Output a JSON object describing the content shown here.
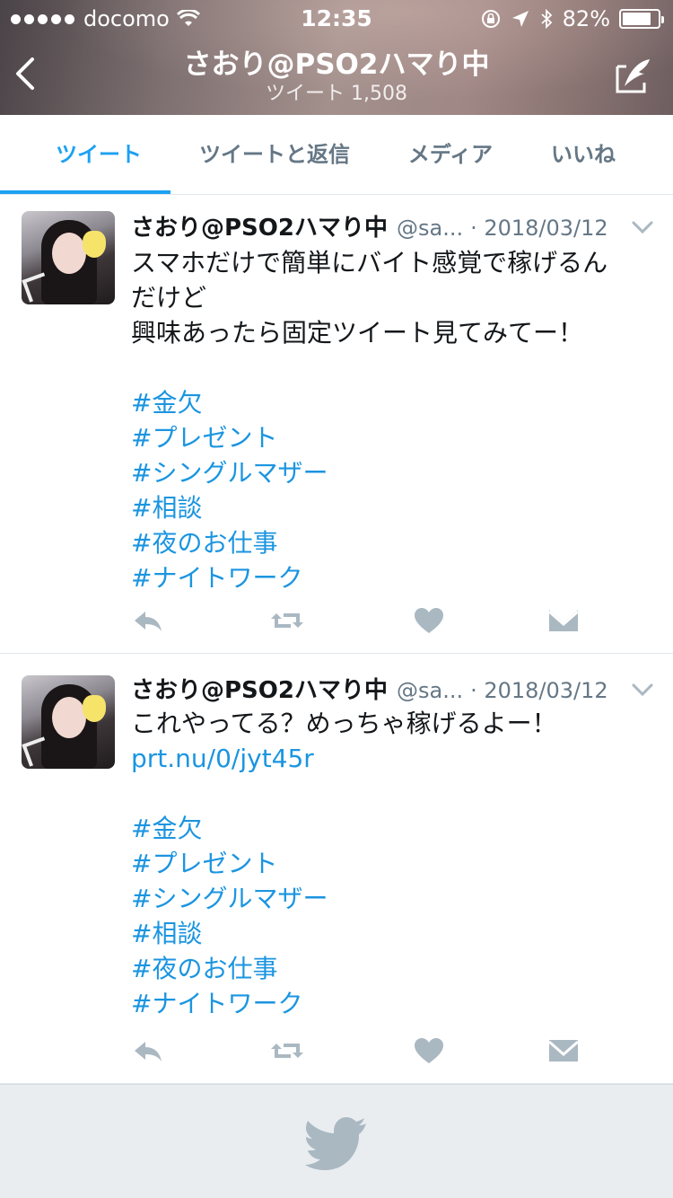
{
  "status_bar": {
    "carrier": "docomo",
    "time": "12:35",
    "battery": "82%",
    "battery_level": 0.82
  },
  "header": {
    "title": "さおり@PSO2ハマり中",
    "subtitle": "ツイート 1,508",
    "back_icon": "chevron-left-icon",
    "compose_icon": "compose-tweet-icon"
  },
  "tabs": [
    {
      "label": "ツイート",
      "active": true
    },
    {
      "label": "ツイートと返信",
      "active": false
    },
    {
      "label": "メディア",
      "active": false
    },
    {
      "label": "いいね",
      "active": false
    }
  ],
  "colors": {
    "accent": "#1da1f2",
    "link": "#1b95e0",
    "secondary_text": "#657786",
    "icon_gray": "#aab8c2"
  },
  "tweets": [
    {
      "name": "さおり@PSO2ハマり中",
      "handle": "@sa...",
      "date": "· 2018/03/12",
      "lines": [
        "スマホだけで簡単にバイト感覚で稼げるん",
        "だけど",
        "興味あったら固定ツイート見てみてー！",
        ""
      ],
      "link": "",
      "hashtags": [
        "#金欠",
        "#プレゼント",
        "#シングルマザー",
        "#相談",
        "#夜のお仕事",
        "#ナイトワーク"
      ]
    },
    {
      "name": "さおり@PSO2ハマり中",
      "handle": "@sa...",
      "date": "· 2018/03/12",
      "lines": [
        "これやってる？めっちゃ稼げるよー！"
      ],
      "link": "prt.nu/0/jyt45r",
      "hashtags": [
        "#金欠",
        "#プレゼント",
        "#シングルマザー",
        "#相談",
        "#夜のお仕事",
        "#ナイトワーク"
      ]
    }
  ],
  "action_icons": [
    "reply-icon",
    "retweet-icon",
    "like-icon",
    "direct-message-icon"
  ],
  "footer_icon": "twitter-bird-icon"
}
